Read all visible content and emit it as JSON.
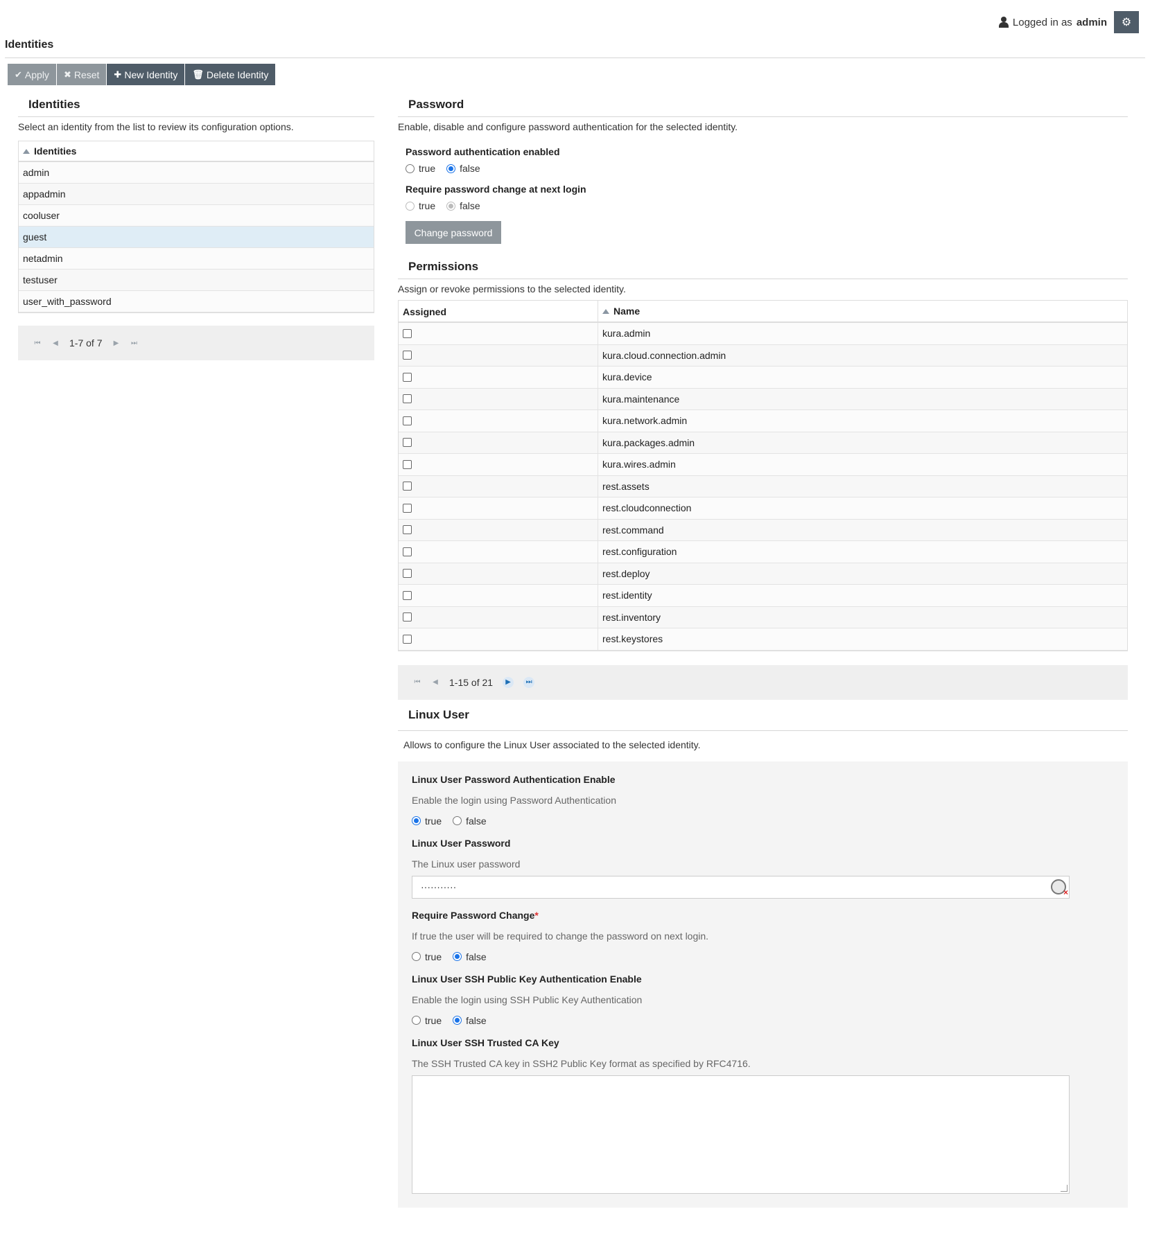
{
  "header": {
    "logged_in_prefix": "Logged in as",
    "username": "admin",
    "settings_icon": "gear-icon"
  },
  "page": {
    "title": "Identities"
  },
  "toolbar": {
    "apply_label": "Apply",
    "reset_label": "Reset",
    "new_identity_label": "New Identity",
    "delete_identity_label": "Delete Identity"
  },
  "identities": {
    "title": "Identities",
    "description": "Select an identity from the list to review its configuration options.",
    "column_header": "Identities",
    "rows": [
      "admin",
      "appadmin",
      "cooluser",
      "guest",
      "netadmin",
      "testuser",
      "user_with_password"
    ],
    "selected": "guest",
    "pager_text": "1-7 of 7"
  },
  "password": {
    "title": "Password",
    "description": "Enable, disable and configure password authentication for the selected identity.",
    "auth_enabled_label": "Password authentication enabled",
    "auth_enabled_value": "false",
    "require_change_label": "Require password change at next login",
    "require_change_value": "false",
    "true_label": "true",
    "false_label": "false",
    "change_button": "Change password"
  },
  "permissions": {
    "title": "Permissions",
    "description": "Assign or revoke permissions to the selected identity.",
    "col_assigned": "Assigned",
    "col_name": "Name",
    "rows": [
      "kura.admin",
      "kura.cloud.connection.admin",
      "kura.device",
      "kura.maintenance",
      "kura.network.admin",
      "kura.packages.admin",
      "kura.wires.admin",
      "rest.assets",
      "rest.cloudconnection",
      "rest.command",
      "rest.configuration",
      "rest.deploy",
      "rest.identity",
      "rest.inventory",
      "rest.keystores"
    ],
    "pager_text": "1-15 of 21"
  },
  "linux_user": {
    "title": "Linux User",
    "description": "Allows to configure the Linux User associated to the selected identity.",
    "pwd_auth_label": "Linux User Password Authentication Enable",
    "pwd_auth_desc": "Enable the login using Password Authentication",
    "pwd_auth_value": "true",
    "password_label": "Linux User Password",
    "password_desc": "The Linux user password",
    "password_value": "···········",
    "require_change_label": "Require Password Change",
    "require_change_star": "*",
    "require_change_desc": "If true the user will be required to change the password on next login.",
    "require_change_value": "false",
    "ssh_auth_label": "Linux User SSH Public Key Authentication Enable",
    "ssh_auth_desc": "Enable the login using SSH Public Key Authentication",
    "ssh_auth_value": "false",
    "ca_key_label": "Linux User SSH Trusted CA Key",
    "ca_key_desc": "The SSH Trusted CA key in SSH2 Public Key format as specified by RFC4716.",
    "ca_key_value": "",
    "true_label": "true",
    "false_label": "false"
  }
}
